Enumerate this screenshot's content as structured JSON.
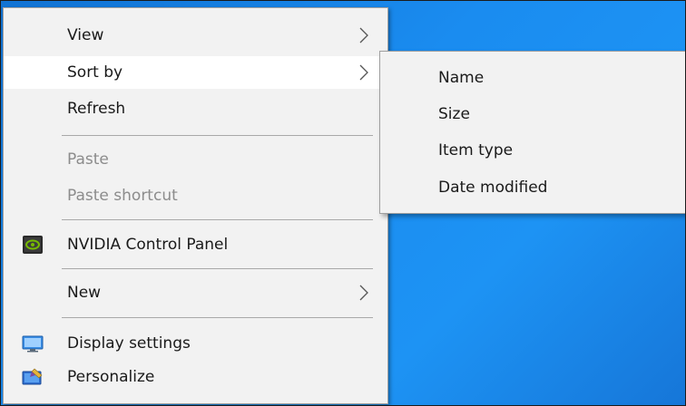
{
  "context_menu": {
    "items": [
      {
        "label": "View",
        "has_submenu": true,
        "icon": "",
        "state": "normal"
      },
      {
        "label": "Sort by",
        "has_submenu": true,
        "icon": "",
        "state": "highlighted"
      },
      {
        "label": "Refresh",
        "has_submenu": false,
        "icon": "",
        "state": "normal"
      },
      {
        "label": "Paste",
        "has_submenu": false,
        "icon": "",
        "state": "disabled"
      },
      {
        "label": "Paste shortcut",
        "has_submenu": false,
        "icon": "",
        "state": "disabled"
      },
      {
        "label": "NVIDIA Control Panel",
        "has_submenu": false,
        "icon": "nvidia-icon",
        "state": "normal"
      },
      {
        "label": "New",
        "has_submenu": true,
        "icon": "",
        "state": "normal"
      },
      {
        "label": "Display settings",
        "has_submenu": false,
        "icon": "display-settings-icon",
        "state": "normal"
      },
      {
        "label": "Personalize",
        "has_submenu": false,
        "icon": "personalize-icon",
        "state": "normal"
      }
    ]
  },
  "sort_submenu": {
    "items": [
      {
        "label": "Name"
      },
      {
        "label": "Size"
      },
      {
        "label": "Item type"
      },
      {
        "label": "Date modified"
      }
    ]
  },
  "colors": {
    "menu_background": "#f2f2f2",
    "highlight": "#ffffff",
    "disabled_text": "#8c8c8c",
    "desktop_blue": "#1a8cf0",
    "nvidia_green": "#76b900"
  }
}
